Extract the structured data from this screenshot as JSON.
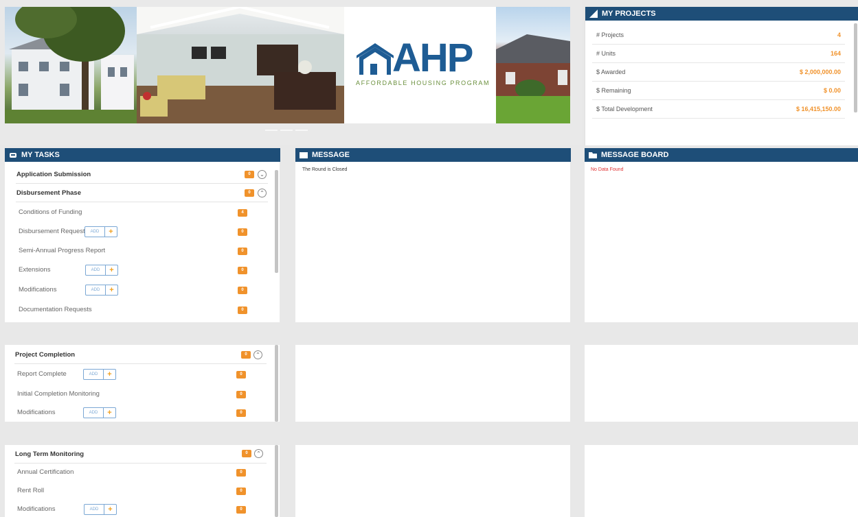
{
  "banner": {
    "logo_main": "AHP",
    "logo_sub": "AFFORDABLE HOUSING PROGRAM"
  },
  "projects": {
    "title": "MY PROJECTS",
    "icon": "bar-chart-icon",
    "rows": [
      {
        "label": "# Projects",
        "value": "4"
      },
      {
        "label": "# Units",
        "value": "164"
      },
      {
        "label": "$ Awarded",
        "value": "$ 2,000,000.00"
      },
      {
        "label": "$ Remaining",
        "value": "$ 0.00"
      },
      {
        "label": "$ Total Development",
        "value": "$ 16,415,150.00"
      }
    ]
  },
  "tasks": {
    "title": "MY TASKS",
    "icon": "inbox-icon",
    "add_label": "ADD",
    "groups": [
      {
        "title": "Application Submission",
        "badge": "0",
        "chevron": "down"
      },
      {
        "title": "Disbursement Phase",
        "badge": "0",
        "chevron": "up",
        "items": [
          {
            "label": "Conditions of Funding",
            "badge": "4"
          },
          {
            "label": "Disbursement Request",
            "badge": "0"
          },
          {
            "label": "Semi-Annual Progress Report",
            "badge": "0"
          },
          {
            "label": "Extensions",
            "badge": "0"
          },
          {
            "label": "Modifications",
            "badge": "0"
          },
          {
            "label": "Documentation Requests",
            "badge": "0"
          }
        ]
      },
      {
        "title": "Project Completion",
        "badge": "0",
        "chevron": "up",
        "items": [
          {
            "label": "Report Complete",
            "badge": "0"
          },
          {
            "label": "Initial Completion Monitoring",
            "badge": "0"
          },
          {
            "label": "Modifications",
            "badge": "0"
          }
        ]
      },
      {
        "title": "Long Term Monitoring",
        "badge": "0",
        "chevron": "up",
        "items": [
          {
            "label": "Annual Certification",
            "badge": "0"
          },
          {
            "label": "Rent Roll",
            "badge": "0"
          },
          {
            "label": "Modifications",
            "badge": "0"
          }
        ]
      }
    ]
  },
  "message": {
    "title": "MESSAGE",
    "icon": "envelope-icon",
    "text": "The Round is Closed"
  },
  "message_board": {
    "title": "MESSAGE BOARD",
    "icon": "folder-icon",
    "text": "No Data Found"
  },
  "colors": {
    "header_bg": "#1e4e78",
    "badge": "#f0922b",
    "value": "#f0922b",
    "error": "#e03030"
  }
}
